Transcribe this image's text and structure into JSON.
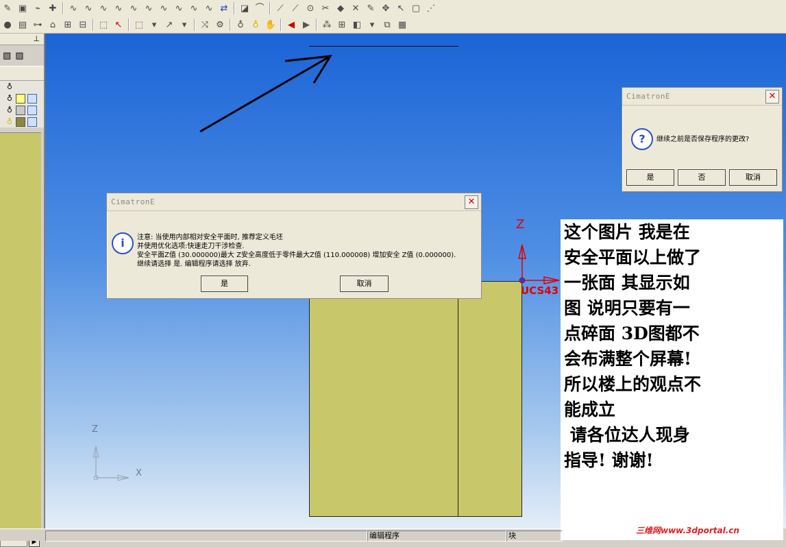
{
  "dialog_main": {
    "title": "CimatronE",
    "close": "✕",
    "message": [
      "注意: 当使用内部相对安全平面时, 推荐定义毛坯",
      "并使用优化选项:快速走刀干涉检查.",
      "安全平面Z值 (30.000000)最大 Z安全高度低于零件最大Z值 (110.000008) 增加安全 Z值 (0.000000).",
      "继续请选择 是. 编辑程序请选择 放弃."
    ],
    "yes_label": "是",
    "cancel_label": "取消",
    "icon": "i"
  },
  "dialog_save": {
    "title": "CimatronE",
    "close": "✕",
    "message": "继续之前是否保存程序的更改?",
    "yes_label": "是",
    "no_label": "否",
    "cancel_label": "取消",
    "icon": "?"
  },
  "viewport": {
    "ucs_label": "UCS43",
    "ucs_axis_z": "Z",
    "corner_axis_z": "Z",
    "corner_axis_x": "X"
  },
  "note_lines": [
    "这个图片 我是在",
    "安全平面以上做了",
    "一张面 其显示如",
    "图 说明只要有一",
    "点碎面 3D图都不",
    "会布满整个屏幕!",
    "所以楼上的观点不",
    "能成立",
    " 请各位达人现身",
    "指导! 谢谢!"
  ],
  "watermark": "三维网www.3dportal.cn",
  "statusbar": {
    "cell1": "",
    "cell2": "编辑程序",
    "cell3": "块"
  },
  "colors": {
    "part_fill": "#c8c86a",
    "viewport_top": "#1b64d6",
    "viewport_bottom": "#e4eef8",
    "ucs_red": "#e00000"
  }
}
